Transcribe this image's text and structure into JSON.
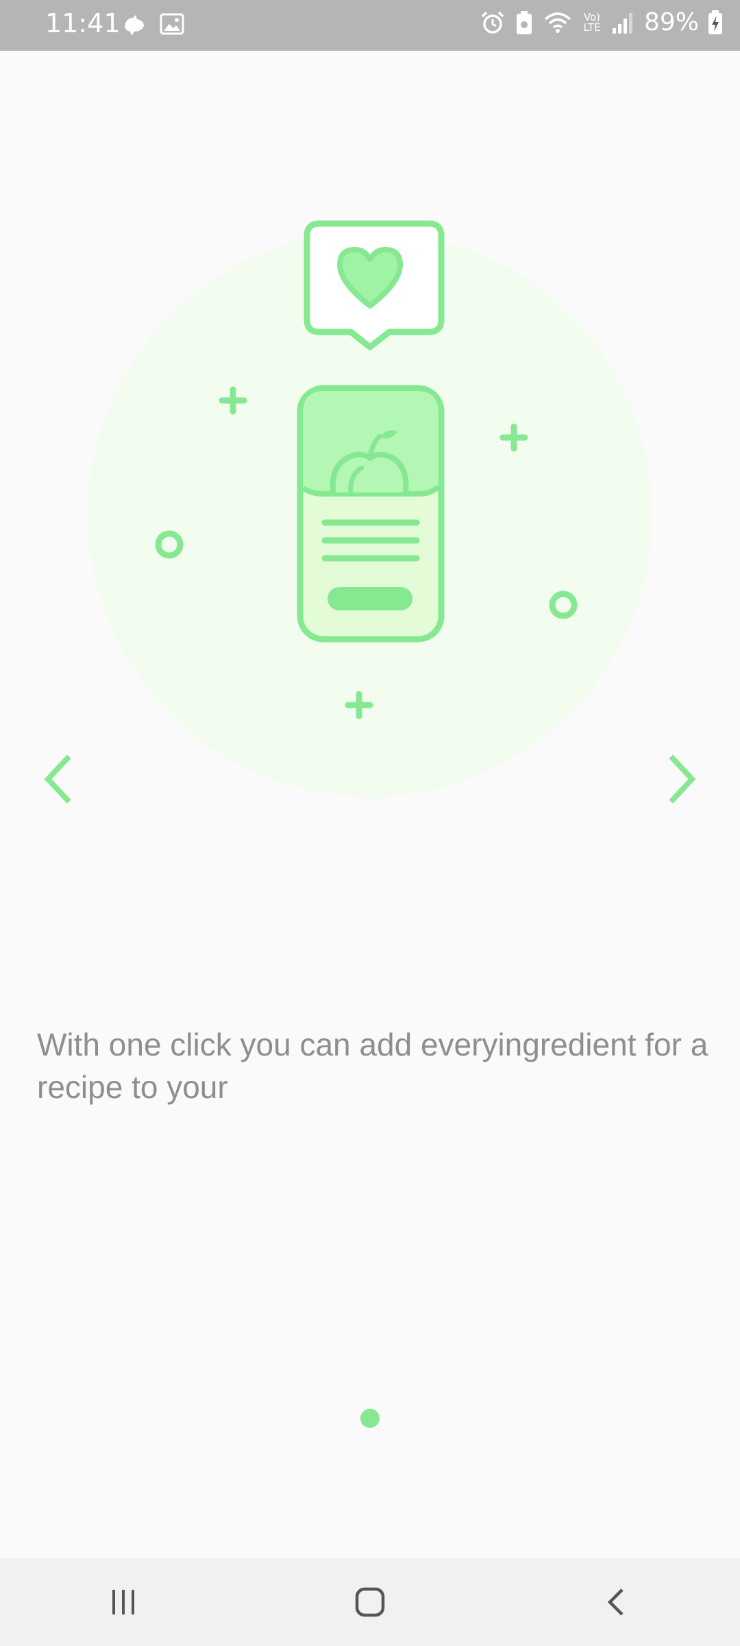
{
  "status_bar": {
    "time": "11:41",
    "battery": "89%",
    "left_icons": [
      "cat-notification-icon",
      "gallery-icon"
    ],
    "right_icons": [
      "alarm-icon",
      "battery-saver-icon",
      "wifi-icon",
      "volte-icon",
      "signal-icon",
      "battery-charging-icon"
    ],
    "volte_label": "Vo) LTE"
  },
  "onboarding": {
    "description": "With one click you can add everyingredient for a recipe to your",
    "page_count": 1,
    "current_page": 1
  },
  "colors": {
    "accent": "#86e891",
    "accent_dark": "#7fe08a",
    "light_green": "#b4f7b4",
    "pale_green": "#e3fbd7",
    "circle_bg": "#f2fdf0",
    "text": "#8e8e8e"
  },
  "navigation": {
    "prev_icon": "chevron-left-icon",
    "next_icon": "chevron-right-icon",
    "system": [
      "recents-button",
      "home-button",
      "back-button"
    ]
  }
}
